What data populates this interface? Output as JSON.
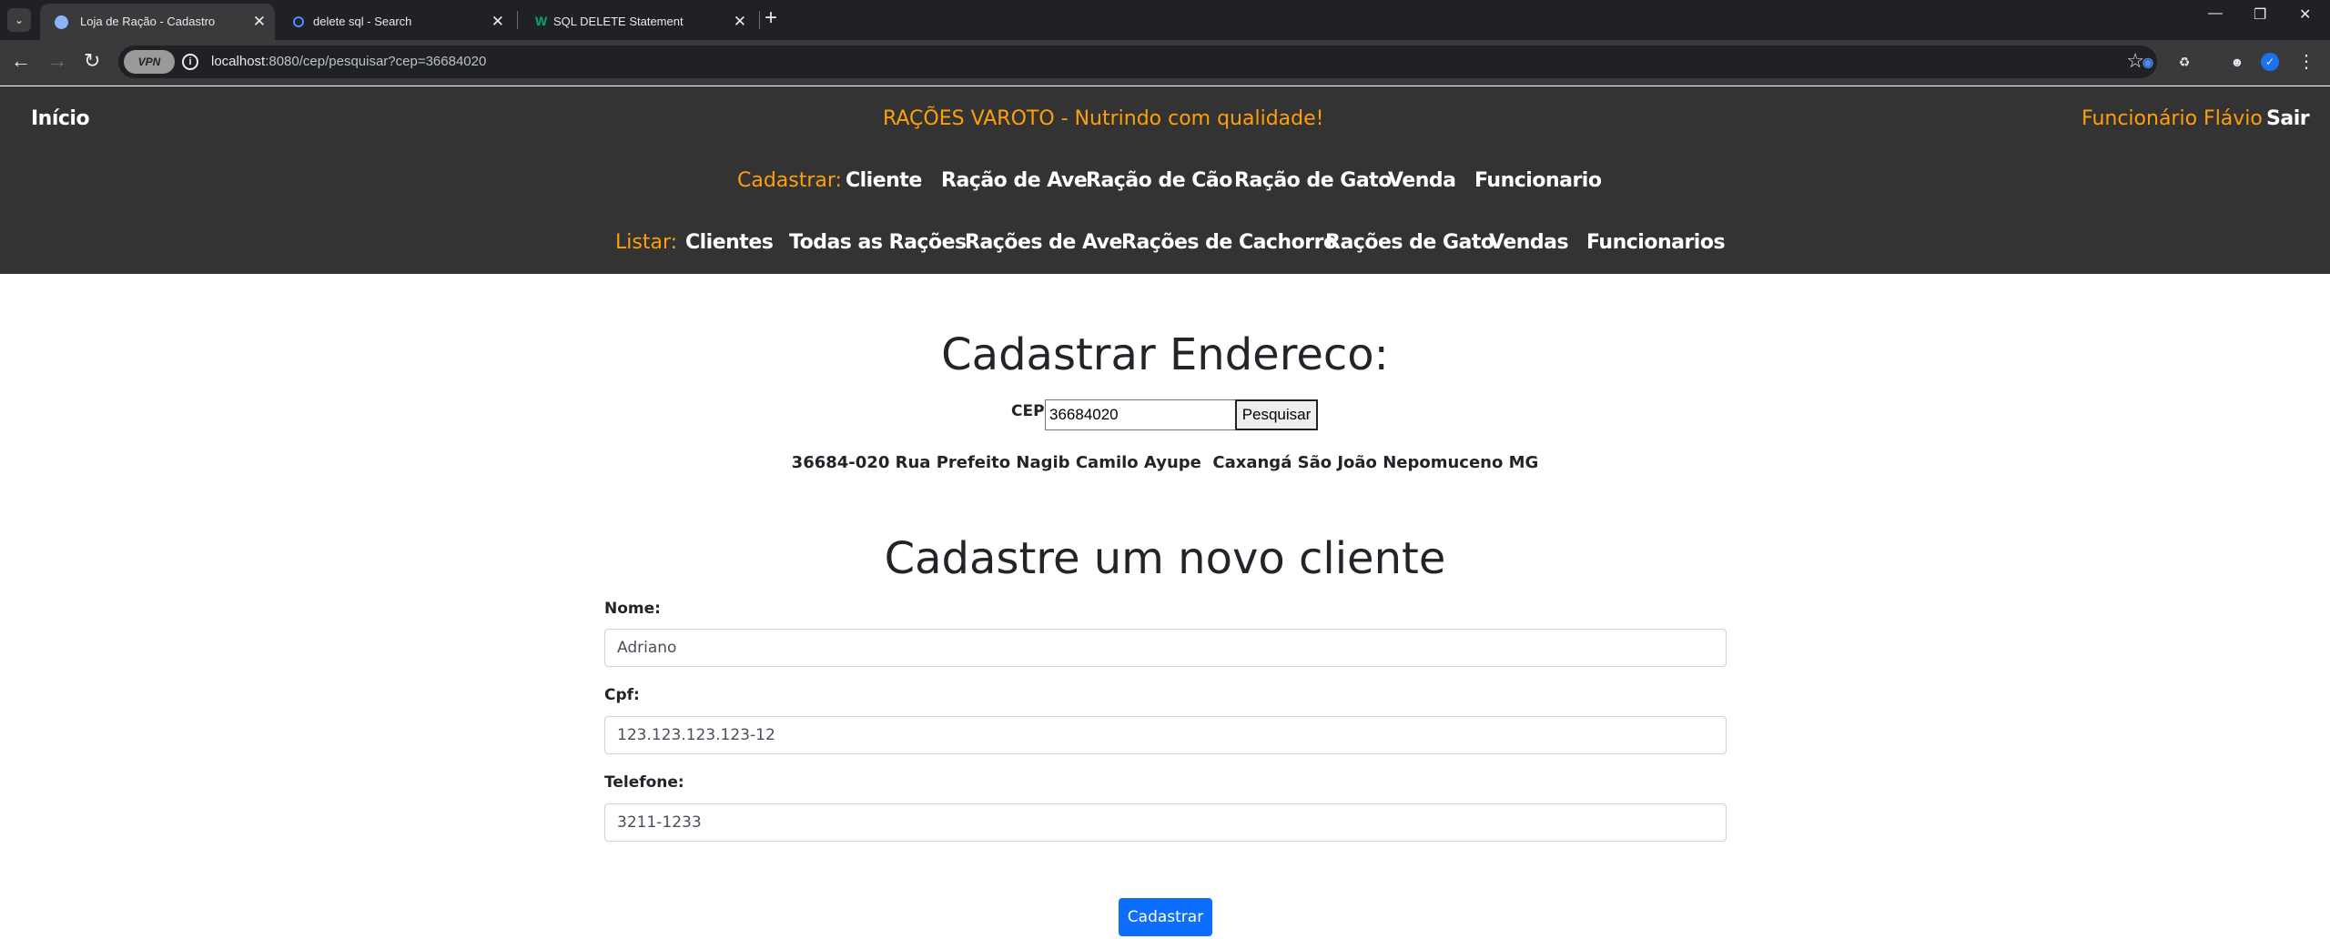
{
  "browser": {
    "tabs": [
      {
        "title": "Loja de Ração - Cadastro",
        "active": true,
        "favicon": "globe-icon"
      },
      {
        "title": "delete sql - Search",
        "active": false,
        "favicon": "search-icon"
      },
      {
        "title": "SQL DELETE Statement",
        "active": false,
        "favicon": "w3schools-icon"
      }
    ],
    "vpn_label": "VPN",
    "url_host": "localhost",
    "url_rest": ":8080/cep/pesquisar?cep=36684020",
    "colors": {
      "tabbar": "#202124",
      "toolbar": "#3a3a3c"
    }
  },
  "navbar": {
    "home": "Início",
    "brand": "RAÇÕES VAROTO - Nutrindo com qualidade!",
    "user": "Funcionário Flávio",
    "logout": "Sair",
    "cadastrar_label": "Cadastrar:",
    "cadastrar_links": [
      "Cliente",
      "Ração de Ave",
      "Ração de Cão",
      "Ração de Gato",
      "Venda",
      "Funcionario"
    ],
    "listar_label": "Listar:",
    "listar_links": [
      "Clientes",
      "Todas as Rações",
      "Rações de Ave",
      "Rações de Cachorro",
      "Rações de Gato",
      "Vendas",
      "Funcionarios"
    ],
    "colors": {
      "background": "#333333",
      "accent": "#ff9f0a",
      "link": "#ffffff"
    }
  },
  "endereco": {
    "heading": "Cadastrar Endereco:",
    "cep_label": "CEP:",
    "cep_value": "36684020",
    "search_button": "Pesquisar",
    "result": "36684-020 Rua Prefeito Nagib Camilo Ayupe  Caxangá São João Nepomuceno MG"
  },
  "cliente_form": {
    "heading": "Cadastre um novo cliente",
    "nome_label": "Nome:",
    "nome_value": "Adriano",
    "cpf_label": "Cpf:",
    "cpf_value": "123.123.123.123-12",
    "telefone_label": "Telefone:",
    "telefone_value": "3211-1233",
    "submit": "Cadastrar",
    "colors": {
      "primary": "#0d6efd"
    }
  }
}
